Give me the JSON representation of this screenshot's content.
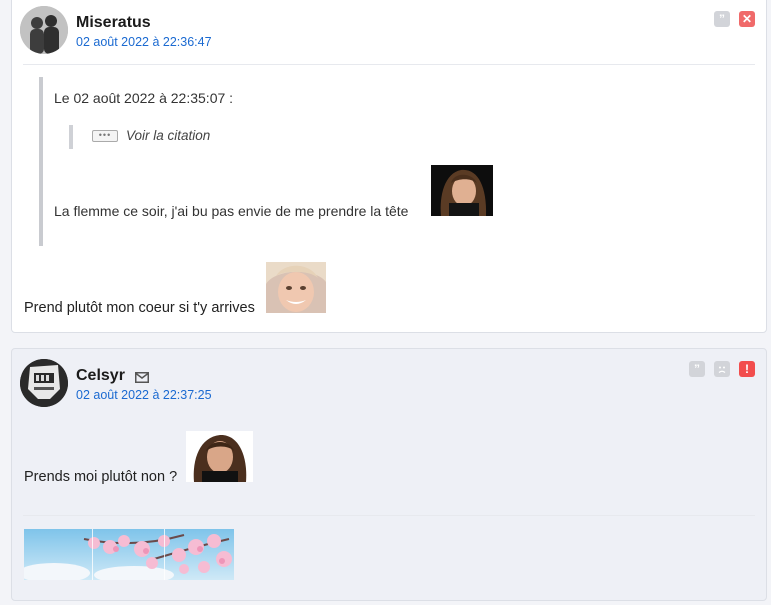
{
  "posts": [
    {
      "username": "Miseratus",
      "date": "02 août 2022 à 22:36:47",
      "quote": {
        "header": "Le 02 août 2022 à 22:35:07 :",
        "view_label": "Voir la citation",
        "dots": "•••",
        "text": "La flemme ce soir, j'ai bu pas envie de me prendre la tête"
      },
      "message": "Prend plutôt mon coeur si t'y arrives",
      "actions": [
        "quote-icon",
        "close-icon"
      ]
    },
    {
      "username": "Celsyr",
      "date": "02 août 2022 à 22:37:25",
      "message": "Prends moi plutôt non ?",
      "actions": [
        "quote-icon",
        "sad-face-icon",
        "alert-icon"
      ]
    }
  ],
  "icons": {
    "quote_glyph": "”",
    "close_glyph": "✕",
    "alert_glyph": "!"
  },
  "colors": {
    "date_link": "#1b6ad1",
    "post1_bg": "#ffffff",
    "post2_bg": "#eef0f6",
    "delete_red": "#f06a6a",
    "alert_red": "#f24d4d"
  }
}
